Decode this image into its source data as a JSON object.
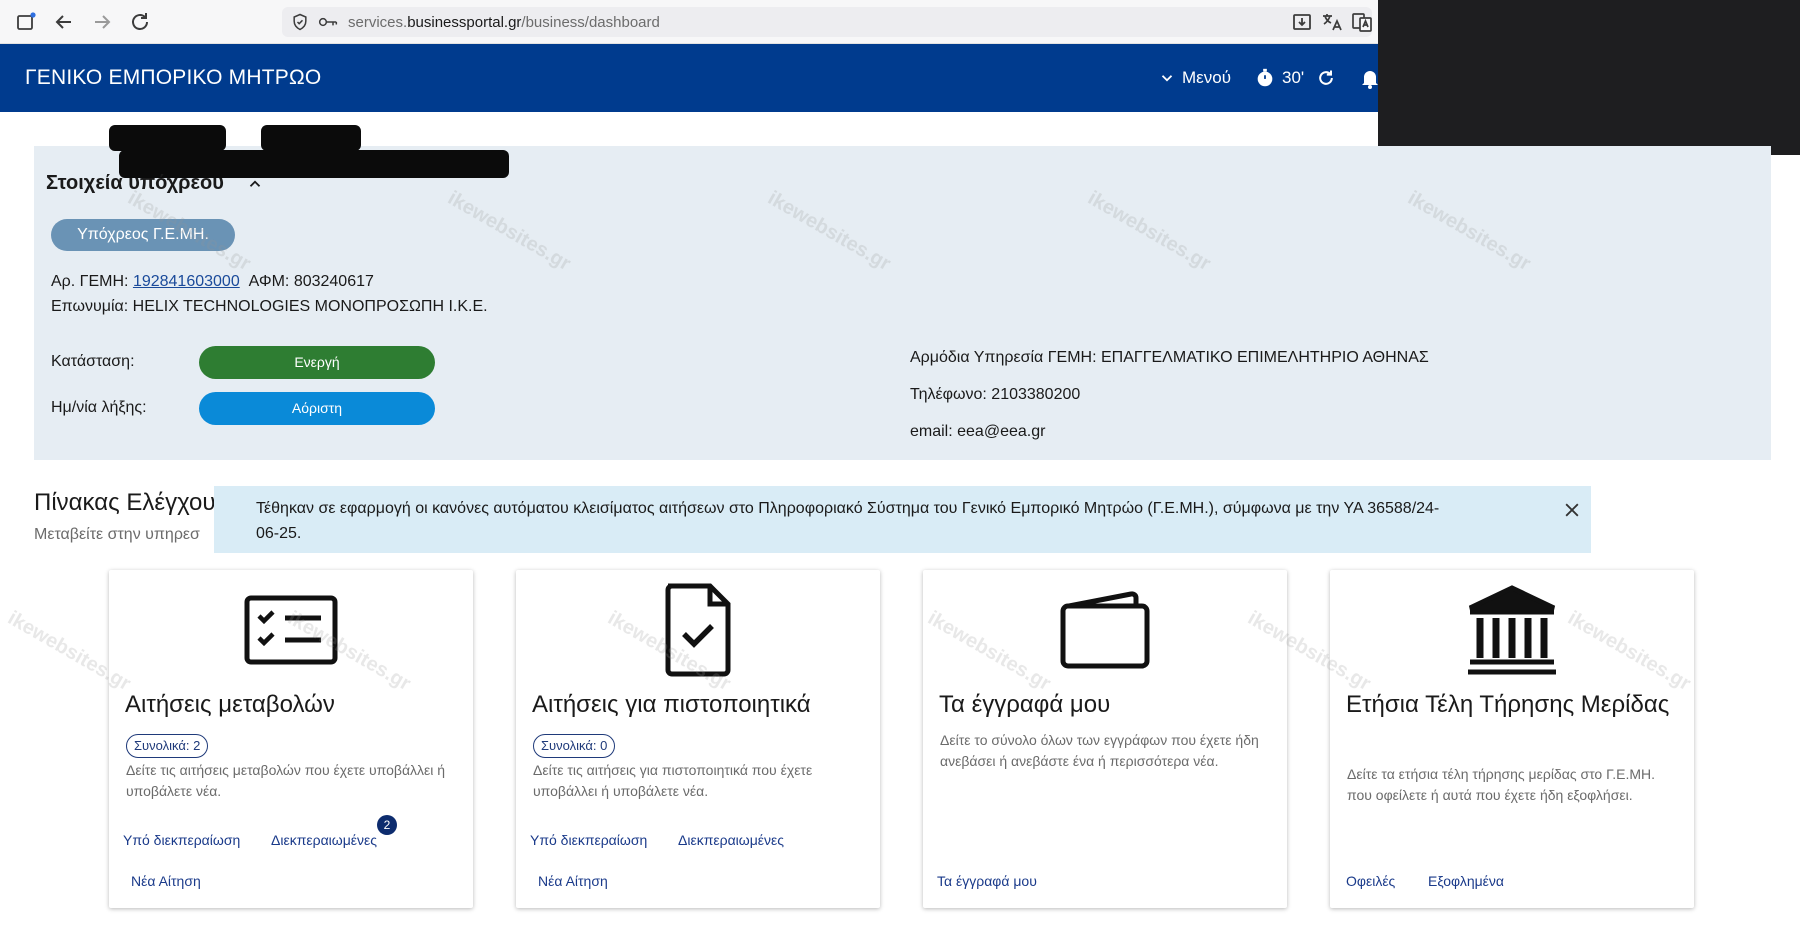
{
  "browser": {
    "url_prefix": "services.",
    "url_host": "businessportal.gr",
    "url_path": "/business/dashboard"
  },
  "header": {
    "title": "ΓΕΝΙΚΟ ΕΜΠΟΡΙΚΟ ΜΗΤΡΩΟ",
    "menu_label": "Μενού",
    "timer_label": "30'",
    "brand_color": "#003b8e"
  },
  "obligor": {
    "section_title": "Στοιχεία υπόχρεου",
    "chip_label": "Υπόχρεος Γ.Ε.ΜΗ.",
    "gemi_label": "Αρ. ΓΕΜΗ:",
    "gemi_number": "192841603000",
    "afm_label": "ΑΦΜ:",
    "afm_number": "803240617",
    "name_label": "Επωνυμία:",
    "name_value": "HELIX TECHNOLOGIES ΜΟΝΟΠΡΟΣΩΠΗ Ι.Κ.Ε.",
    "status_label": "Κατάσταση:",
    "status_value": "Ενεργή",
    "expiry_label": "Ημ/νία λήξης:",
    "expiry_value": "Αόριστη",
    "service_line": "Αρμόδια Υπηρεσία ΓΕΜΗ: ΕΠΑΓΓΕΛΜΑΤΙΚΟ ΕΠΙΜΕΛΗΤΗΡΙΟ ΑΘΗΝΑΣ",
    "phone_line": "Τηλέφωνο: 2103380200",
    "email_line": "email: eea@eea.gr"
  },
  "dashboard": {
    "title": "Πίνακας Ελέγχου",
    "subtitle": "Μεταβείτε στην υπηρεσ",
    "alert_text": "Τέθηκαν σε εφαρμογή οι κανόνες αυτόματου κλεισίματος αιτήσεων στο Πληροφοριακό Σύστημα του Γενικό Εμπορικό Μητρώο (Γ.Ε.ΜΗ.), σύμφωνα με την ΥΑ 36588/24-06-25."
  },
  "cards": [
    {
      "icon": "checklist-icon",
      "title": "Αιτήσεις μεταβολών",
      "badge": "Συνολικά: 2",
      "description": "Δείτε τις αιτήσεις μεταβολών που έχετε υποβάλλει ή υποβάλετε νέα.",
      "link_pending": "Υπό διεκπεραίωση",
      "link_done": "Διεκπεραιωμένες",
      "done_count": "2",
      "link_new": "Νέα Αίτηση"
    },
    {
      "icon": "document-check-icon",
      "title": "Αιτήσεις για πιστοποιητικά",
      "badge": "Συνολικά: 0",
      "description": "Δείτε τις αιτήσεις για πιστοποιητικά που έχετε υποβάλλει ή υποβάλετε νέα.",
      "link_pending": "Υπό διεκπεραίωση",
      "link_done": "Διεκπεραιωμένες",
      "link_new": "Νέα Αίτηση"
    },
    {
      "icon": "wallet-icon",
      "title": "Τα έγγραφά μου",
      "description": "Δείτε το σύνολο όλων των εγγράφων που έχετε ήδη ανεβάσει ή ανεβάστε ένα ή περισσότερα νέα.",
      "link_main": "Τα έγγραφά μου"
    },
    {
      "icon": "bank-building-icon",
      "title": "Ετήσια Τέλη Τήρησης Μερίδας",
      "description": "Δείτε τα ετήσια τέλη τήρησης μερίδας στο Γ.Ε.ΜΗ. που οφείλετε ή αυτά που έχετε ήδη εξοφλήσει.",
      "link_debts": "Οφειλές",
      "link_paid": "Εξοφλημένα"
    }
  ],
  "watermark": "ikewebsites.gr"
}
